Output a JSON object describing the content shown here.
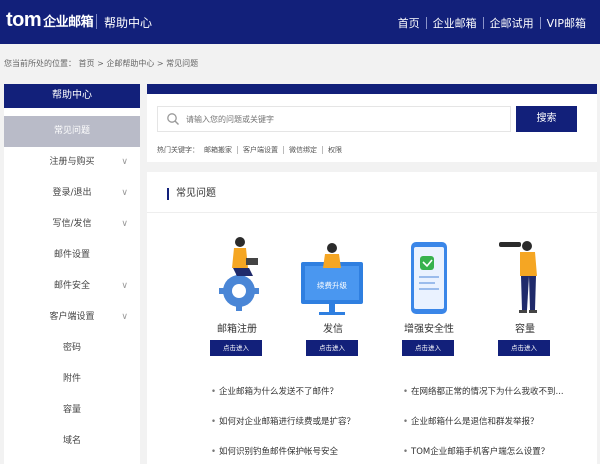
{
  "header": {
    "logo_main": "tom",
    "logo_sub": "企业邮箱",
    "help_center": "帮助中心",
    "nav": [
      "首页",
      "企业邮箱",
      "企邮试用",
      "VIP邮箱"
    ]
  },
  "breadcrumb": "您当前所处的位置： 首页 > 企邮帮助中心 > 常见问题",
  "sidebar": {
    "title": "帮助中心",
    "items": [
      {
        "label": "常见问题",
        "chevron": false
      },
      {
        "label": "注册与购买",
        "chevron": true
      },
      {
        "label": "登录/退出",
        "chevron": true
      },
      {
        "label": "写信/发信",
        "chevron": true
      },
      {
        "label": "邮件设置",
        "chevron": false
      },
      {
        "label": "邮件安全",
        "chevron": true
      },
      {
        "label": "客户端设置",
        "chevron": true
      },
      {
        "label": "密码",
        "chevron": false
      },
      {
        "label": "附件",
        "chevron": false
      },
      {
        "label": "容量",
        "chevron": false
      },
      {
        "label": "域名",
        "chevron": false
      }
    ]
  },
  "search": {
    "placeholder": "请输入您的问题或关键字",
    "button": "搜索",
    "hot_label": "热门关键字：",
    "hot_keywords": [
      "邮箱搬家",
      "客户端设置",
      "微信绑定",
      "权限"
    ]
  },
  "faq": {
    "heading": "常见问题",
    "upgrade_text": "续费升级",
    "enter_label": "点击进入",
    "categories": [
      "邮箱注册",
      "发信",
      "增强安全性",
      "容量"
    ],
    "questions": [
      "企业邮箱为什么发送不了邮件？",
      "在网络都正常的情况下为什么我收不到...",
      "如何对企业邮箱进行续费或是扩容？",
      "企业邮箱什么是退信和群发举报？",
      "如何识别钓鱼邮件保护帐号安全",
      "TOM企业邮箱手机客户端怎么设置？"
    ]
  }
}
